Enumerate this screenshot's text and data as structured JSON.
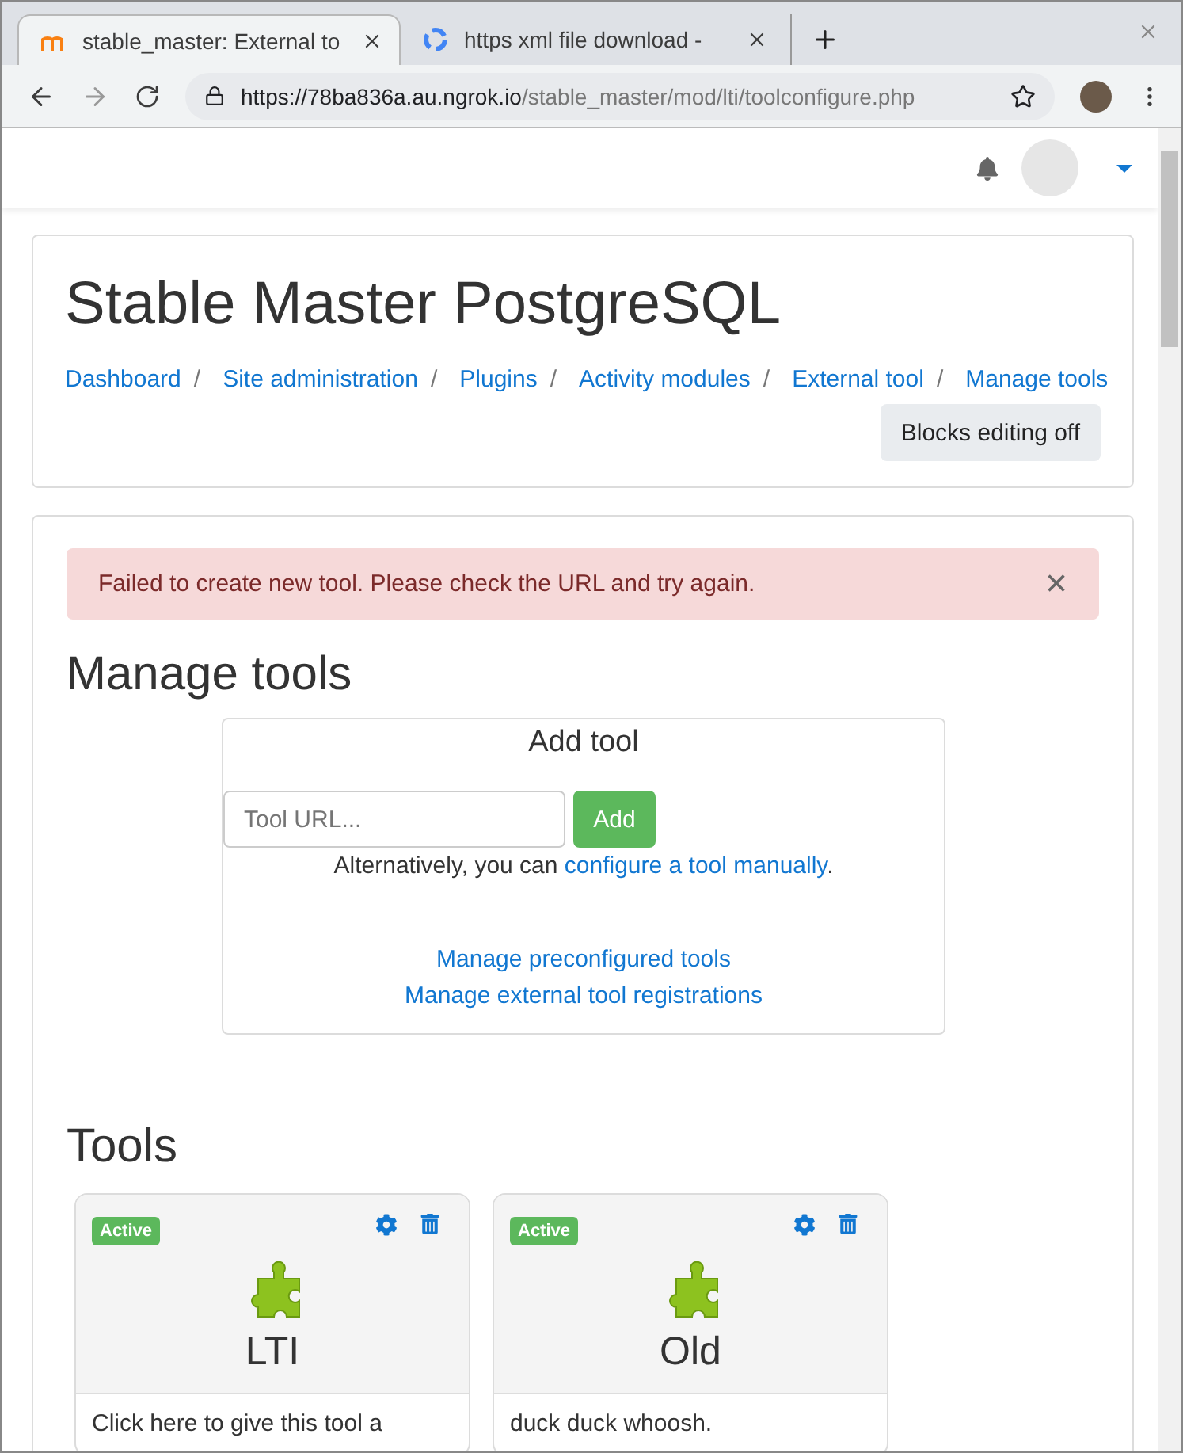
{
  "browser": {
    "tabs": [
      {
        "title": "stable_master: External to",
        "selected": true,
        "kind": "moodle"
      },
      {
        "title": "https xml file download -",
        "selected": false,
        "kind": "google"
      }
    ],
    "address": {
      "host": "https://78ba836a.au.ngrok.io",
      "path": "/stable_master/mod/lti/toolconfigure.php"
    }
  },
  "header": {
    "title": "Stable Master PostgreSQL",
    "breadcrumb": [
      "Dashboard",
      "Site administration",
      "Plugins",
      "Activity modules",
      "External tool",
      "Manage tools"
    ],
    "separator": "/",
    "button": "Blocks editing off"
  },
  "alert": {
    "message": "Failed to create new tool. Please check the URL and try again.",
    "close": "×"
  },
  "page_heading": "Manage tools",
  "add_tool": {
    "title": "Add tool",
    "placeholder": "Tool URL...",
    "button": "Add",
    "alt_prefix": "Alternatively, you can ",
    "alt_link": "configure a tool manually",
    "alt_suffix": ".",
    "links": [
      "Manage preconfigured tools",
      "Manage external tool registrations"
    ]
  },
  "tools_heading": "Tools",
  "tools": [
    {
      "status": "Active",
      "name": "LTI",
      "description": "Click here to give this tool a"
    },
    {
      "status": "Active",
      "name": "Old",
      "description": "duck duck whoosh."
    }
  ]
}
